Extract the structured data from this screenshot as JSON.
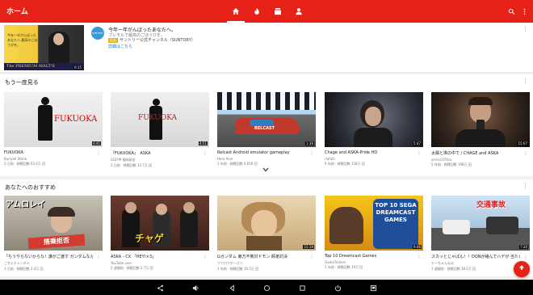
{
  "topbar": {
    "title": "ホーム",
    "tabs": [
      "home-icon",
      "trending-icon",
      "subscriptions-icon",
      "account-icon"
    ],
    "accent": "#e62117"
  },
  "promo": {
    "title": "今年一年がんばったあなたへ。",
    "subtitle": "プレモルで最高のごほうびを。",
    "ad_badge": "広告",
    "channel": "サントリー公式チャンネル（SUNTORY）",
    "link": "詳細はこちら",
    "thumb_text": "今年一年がんばった あなたへ 最高のごほうびを。",
    "thumb_brand": "The PREMIUM MALT'S",
    "duration": "0:15",
    "avatar_text": "SUNTORY"
  },
  "section1": {
    "title": "もう一度見る",
    "videos": [
      {
        "title": "FUKUOKA",
        "channel": "Buriyah Stone",
        "meta": "2 日前 · 視聴回数 63.4万 回",
        "duration": "4:41",
        "thumb_text": "FUKUOKA"
      },
      {
        "title": "『FUKUOKA』　ASKA",
        "channel": "LESYM 福岡発信",
        "meta": "2 日前 · 視聴回数 12.7万 回",
        "duration": "4:51",
        "thumb_text": "FUKUOKA"
      },
      {
        "title": "Relcast Android emulator gameplay",
        "channel": "Hero Acer",
        "meta": "1 年前 · 視聴回数 4,650 回",
        "duration": "1:36",
        "thumb_text": "RELCAST"
      },
      {
        "title": "Chage and ASKA-Pride HD",
        "channel": "riafafs",
        "meta": "6 年前 · 視聴回数 158万 回",
        "duration": "5:47",
        "thumb_text": ""
      },
      {
        "title": "太陽と埃の中で / CHAGE and ASKA",
        "channel": "yince1979ca",
        "meta": "5 年前 · 視聴回数 198万 回",
        "duration": "15:07",
        "thumb_text": ""
      }
    ],
    "expand_icon": "chevron-down-icon"
  },
  "section2": {
    "title": "あなたへのおすすめ",
    "videos": [
      {
        "title": "「ちうやらないからな！誰がご渡す ガンダムなんかに乗ってやるもんかよ！」",
        "channel": "こずエチャンネル",
        "meta": "1 日前 · 視聴回数 2.4万 回",
        "duration": "",
        "thumb_text": "アムロレイ"
      },
      {
        "title": "ASKA - CX 「HEY!×3」",
        "channel": "YouTube user",
        "meta": "2 週間前 · 視聴回数 2.7万 回",
        "duration": "",
        "thumb_text": "チャゲ"
      },
      {
        "title": "Gガンダム 東方不敗対ドモン 師弟対決",
        "channel": "ククロウボーガン",
        "meta": "1 年前 · 視聴回数 16.5万 回",
        "duration": "15:19",
        "thumb_text": ""
      },
      {
        "title": "Top 10 Dreamcast Games",
        "channel": "GameTrailers",
        "meta": "1 年前 · 視聴回数 39万 回",
        "duration": "9:46",
        "thumb_text": "TOP 10 SEGA DREAMCAST GAMES"
      },
      {
        "title": "スカッとじゃぱん！！DQNが絡んでハデが 当たる動画！高級映像集　２０１６　その",
        "channel": "ドーちゃんねる",
        "meta": "1 週間前 · 視聴回数 38.5万 回",
        "duration": "7:20",
        "thumb_text": "交通事故"
      }
    ]
  },
  "fab_icon": "arrow-up-icon",
  "navbar": {
    "icons": [
      "share-icon",
      "volume-icon",
      "back-icon",
      "home-circle-icon",
      "recents-icon",
      "power-icon",
      "screenshot-icon"
    ]
  }
}
